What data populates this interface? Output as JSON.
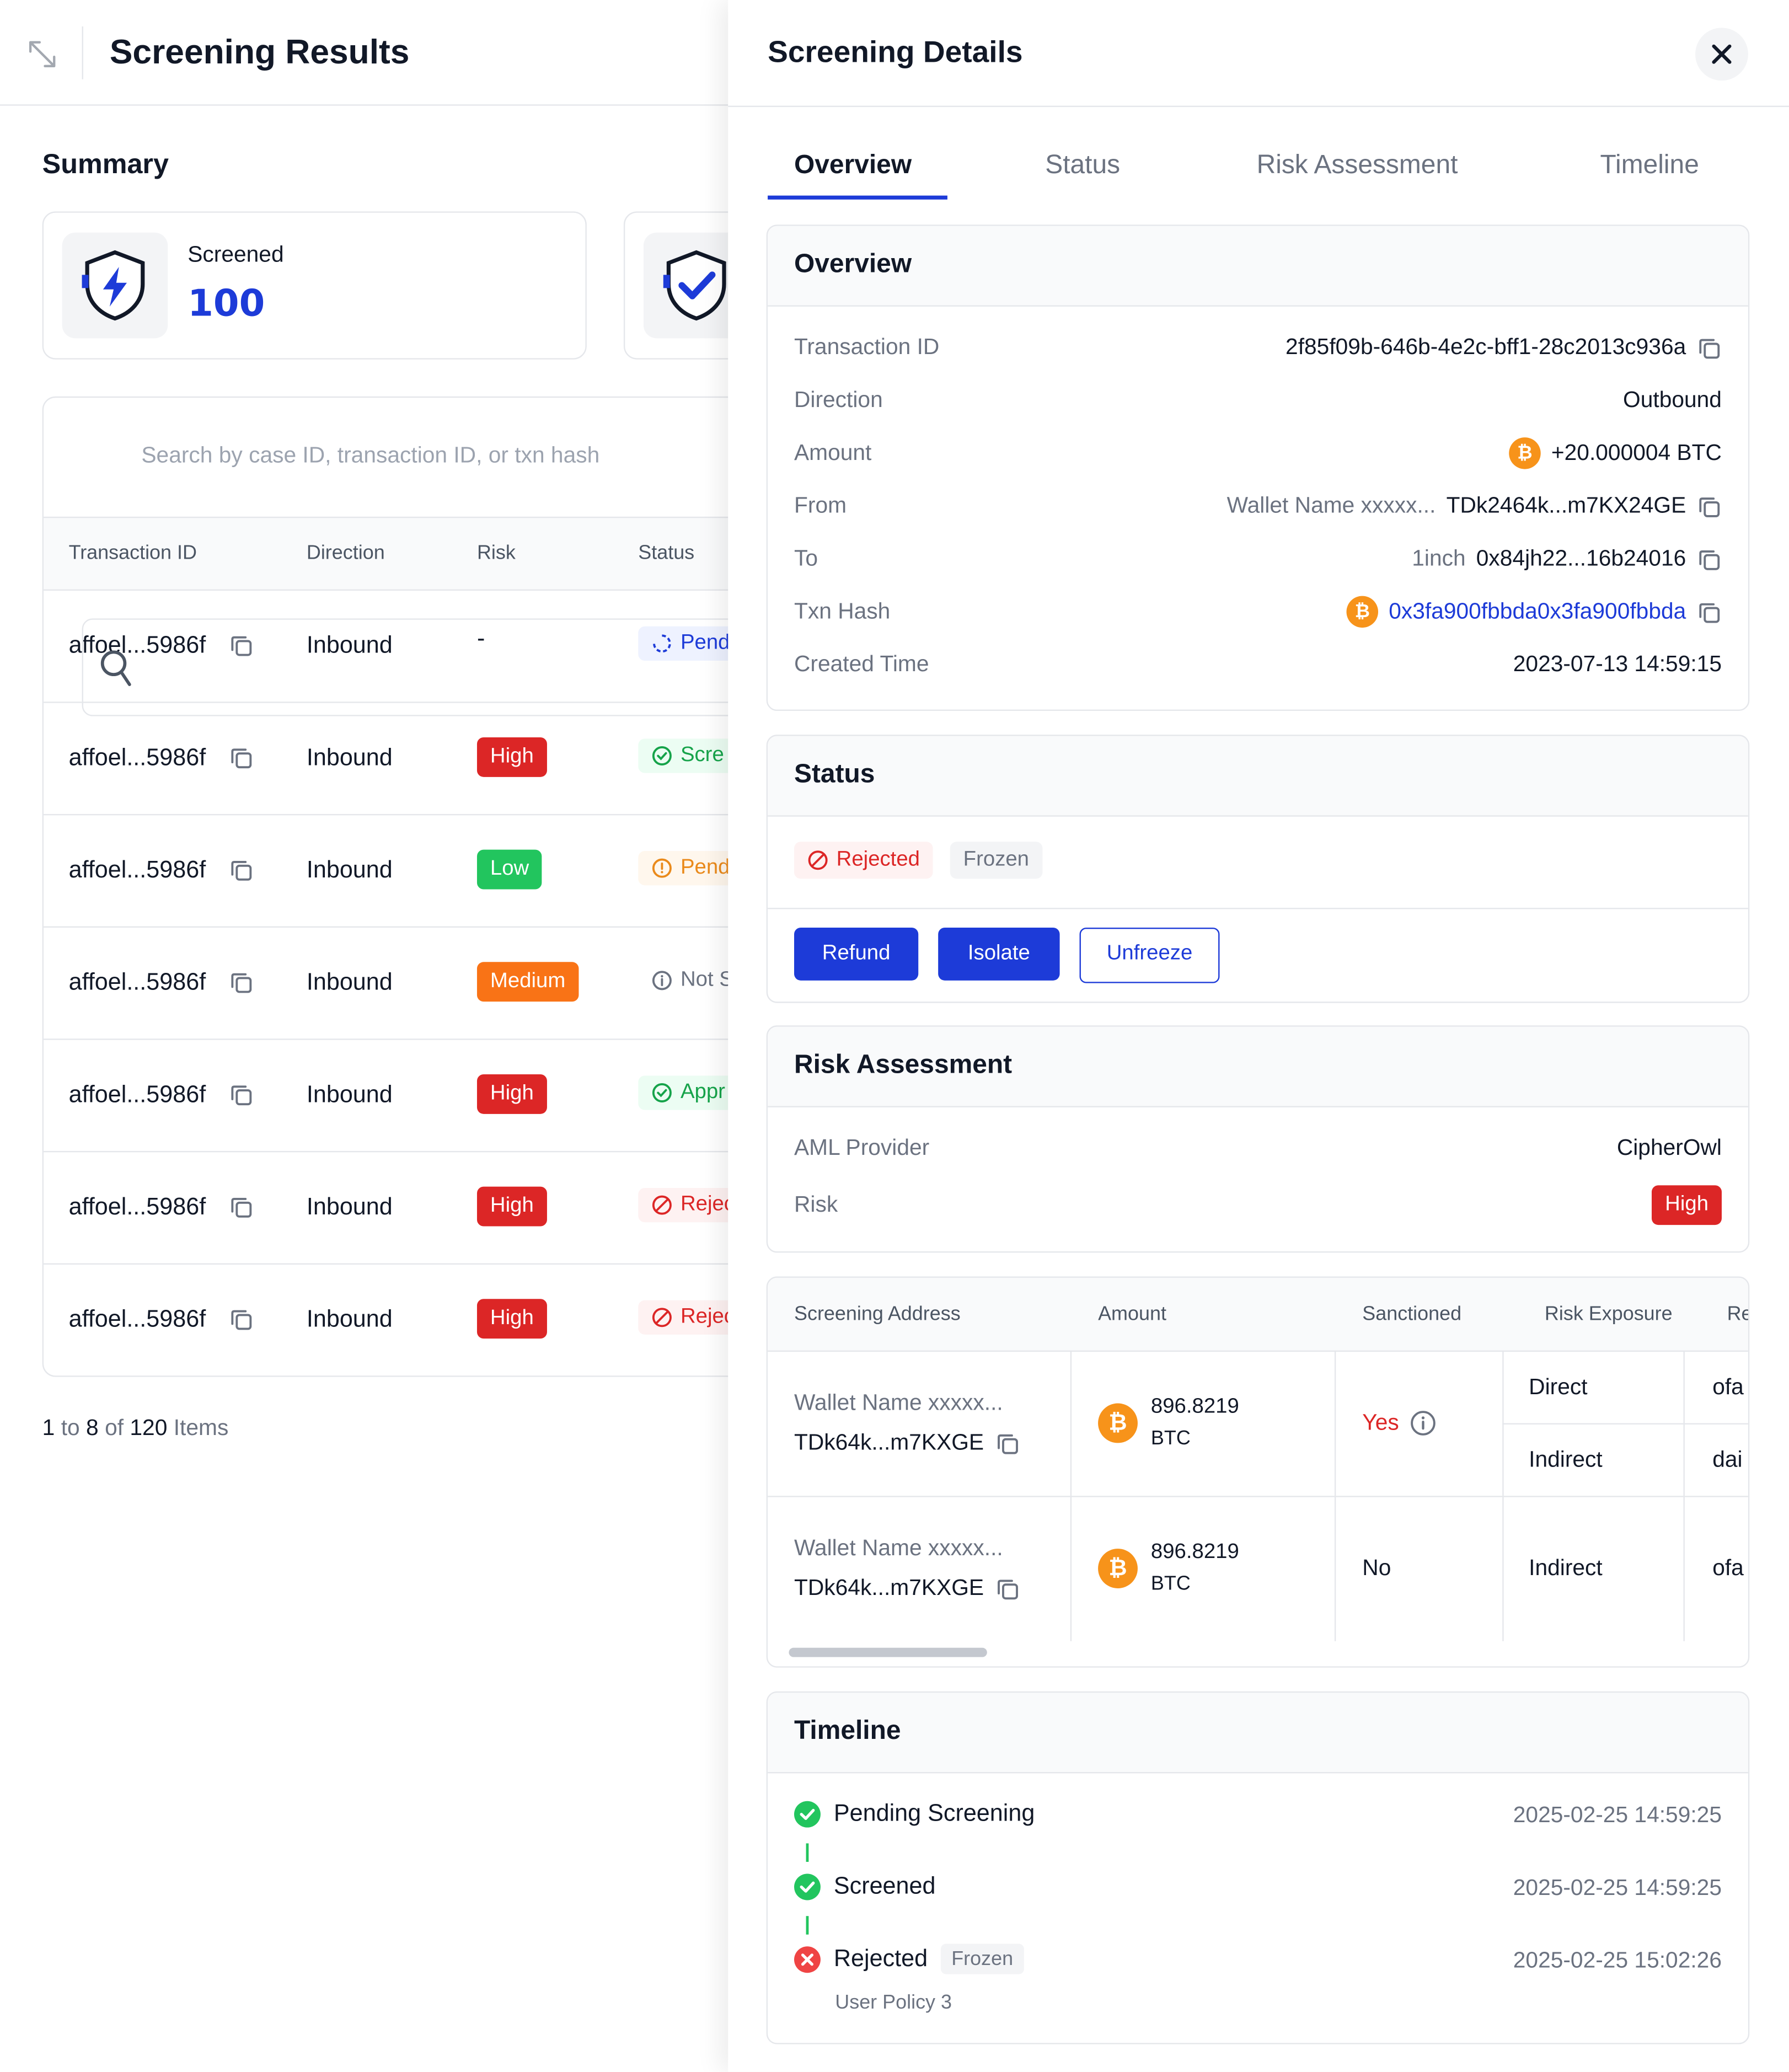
{
  "left": {
    "title": "Screening Results",
    "summary_title": "Summary",
    "cards": [
      {
        "label": "Screened",
        "value": "100"
      },
      {
        "label": "",
        "value": ""
      }
    ],
    "search_placeholder": "Search by case ID, transaction ID, or txn hash",
    "columns": [
      "Transaction ID",
      "Direction",
      "Risk",
      "Status"
    ],
    "rows": [
      {
        "id": "affoel...5986f",
        "direction": "Inbound",
        "risk": "-",
        "risk_level": "none",
        "status": "Pend",
        "status_kind": "pending-blue"
      },
      {
        "id": "affoel...5986f",
        "direction": "Inbound",
        "risk": "High",
        "risk_level": "high",
        "status": "Scre",
        "status_kind": "green"
      },
      {
        "id": "affoel...5986f",
        "direction": "Inbound",
        "risk": "Low",
        "risk_level": "low",
        "status": "Pend",
        "status_kind": "orange"
      },
      {
        "id": "affoel...5986f",
        "direction": "Inbound",
        "risk": "Medium",
        "risk_level": "medium",
        "status": "Not S",
        "status_kind": "gray"
      },
      {
        "id": "affoel...5986f",
        "direction": "Inbound",
        "risk": "High",
        "risk_level": "high",
        "status": "Appr",
        "status_kind": "green"
      },
      {
        "id": "affoel...5986f",
        "direction": "Inbound",
        "risk": "High",
        "risk_level": "high",
        "status": "Rejec",
        "status_kind": "red"
      },
      {
        "id": "affoel...5986f",
        "direction": "Inbound",
        "risk": "High",
        "risk_level": "high",
        "status": "Rejec",
        "status_kind": "red"
      }
    ],
    "pagination": {
      "from": "1",
      "to_word": "to",
      "to": "8",
      "of_word": "of",
      "total": "120",
      "items_word": "Items"
    }
  },
  "drawer": {
    "title": "Screening Details",
    "tabs": [
      "Overview",
      "Status",
      "Risk Assessment",
      "Timeline"
    ],
    "active_tab": "Overview",
    "overview": {
      "title": "Overview",
      "transaction_id_label": "Transaction ID",
      "transaction_id": "2f85f09b-646b-4e2c-bff1-28c2013c936a",
      "direction_label": "Direction",
      "direction": "Outbound",
      "amount_label": "Amount",
      "amount": "+20.000004 BTC",
      "from_label": "From",
      "from_name": "Wallet Name xxxxx...",
      "from_address": "TDk2464k...m7KX24GE",
      "to_label": "To",
      "to_name": "1inch",
      "to_address": "0x84jh22...16b24016",
      "txn_hash_label": "Txn Hash",
      "txn_hash": "0x3fa900fbbda0x3fa900fbbda",
      "created_label": "Created Time",
      "created": "2023-07-13 14:59:15"
    },
    "status": {
      "title": "Status",
      "tag_rejected": "Rejected",
      "tag_frozen": "Frozen",
      "refund": "Refund",
      "isolate": "Isolate",
      "unfreeze": "Unfreeze"
    },
    "risk": {
      "title": "Risk Assessment",
      "provider_label": "AML Provider",
      "provider": "CipherOwl",
      "risk_label": "Risk",
      "risk": "High"
    },
    "address_table": {
      "columns": [
        "Screening Address",
        "Amount",
        "Sanctioned",
        "Risk Exposure",
        "Re"
      ],
      "rows": [
        {
          "name": "Wallet Name xxxxx...",
          "address": "TDk64k...m7KXGE",
          "amount": "896.8219",
          "unit": "BTC",
          "sanctioned": "Yes",
          "exposure_1": "Direct",
          "extra_1": "ofa",
          "exposure_2": "Indirect",
          "extra_2": "dai"
        },
        {
          "name": "Wallet Name xxxxx...",
          "address": "TDk64k...m7KXGE",
          "amount": "896.8219",
          "unit": "BTC",
          "sanctioned": "No",
          "exposure_1": "Indirect",
          "extra_1": "ofa"
        }
      ]
    },
    "timeline": {
      "title": "Timeline",
      "items": [
        {
          "label": "Pending Screening",
          "time": "2025-02-25 14:59:25"
        },
        {
          "label": "Screened",
          "time": "2025-02-25 14:59:25"
        },
        {
          "label": "Rejected",
          "tag": "Frozen",
          "time": "2025-02-25 15:02:26",
          "sub": "User Policy 3"
        }
      ]
    }
  },
  "colors": {
    "accent": "#1d3bd8",
    "high": "#dc2626",
    "low": "#22c55e",
    "medium": "#f97316",
    "btc": "#f7931a"
  }
}
